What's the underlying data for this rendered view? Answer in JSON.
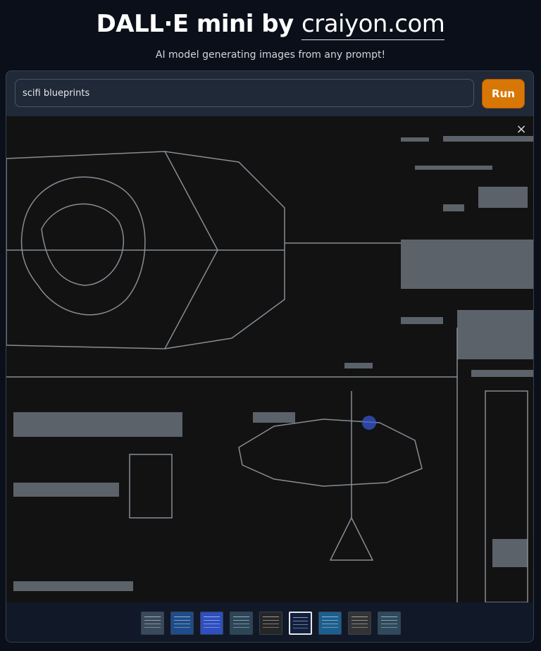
{
  "header": {
    "title_prefix": "DALL·E mini by ",
    "title_brand": "craiyon.com",
    "subtitle": "AI model generating images from any prompt!"
  },
  "prompt": {
    "value": "scifi blueprints",
    "run_label": "Run"
  },
  "gallery": {
    "close_label": "×",
    "thumbnails": [
      {
        "color": "#3a4a5c"
      },
      {
        "color": "#1e4c8a"
      },
      {
        "color": "#2d4fbf"
      },
      {
        "color": "#2c4658"
      },
      {
        "color": "#262626"
      },
      {
        "color": "#12203f",
        "selected": true
      },
      {
        "color": "#1c5f8f"
      },
      {
        "color": "#333333"
      },
      {
        "color": "#2e4a5c"
      }
    ]
  }
}
